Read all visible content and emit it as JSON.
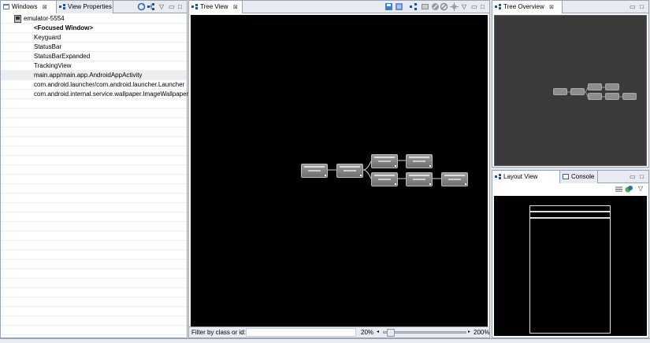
{
  "windows_panel": {
    "tabs": [
      {
        "label": "Windows",
        "close": "⊠"
      },
      {
        "label": "View Properties"
      }
    ],
    "device": "emulator-5554",
    "items": [
      "<Focused Window>",
      "Keyguard",
      "StatusBar",
      "StatusBarExpanded",
      "TrackingView",
      "main.app/main.app.AndroidAppActivity",
      "com.android.launcher/com.android.launcher.Launcher",
      "com.android.internal.service.wallpaper.ImageWallpaper"
    ]
  },
  "tree_view": {
    "tab_label": "Tree View",
    "close": "⊠",
    "filter_label": "Filter by class or id:",
    "zoom_min": "20%",
    "zoom_max": "200%",
    "zoom_fraction": 0.05
  },
  "tree_overview": {
    "tab_label": "Tree Overview",
    "close": "⊠"
  },
  "layout_view": {
    "tab_label": "Layout View",
    "console_label": "Console"
  },
  "colors": {
    "canvas": "#000000",
    "overview_bg": "#3a3a3a",
    "node": "#7c7c7c",
    "tab_bg": "#e8ecf2",
    "border": "#99a4b3"
  }
}
